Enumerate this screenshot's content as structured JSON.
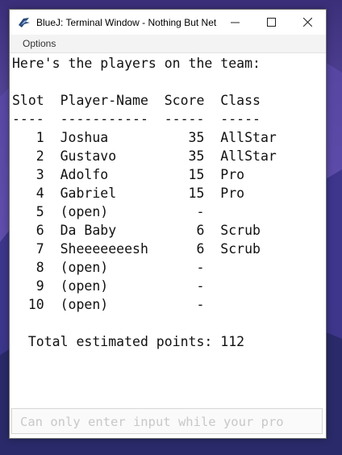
{
  "window": {
    "title": "BlueJ: Terminal Window - Nothing But Net",
    "minimize_glyph": "—",
    "maximize_glyph": "☐",
    "close_glyph": "✕"
  },
  "menu": {
    "options": "Options"
  },
  "terminal": {
    "lines": [
      "Here's the players on the team:",
      "",
      "Slot  Player-Name  Score  Class",
      "----  -----------  -----  -----",
      "   1  Joshua          35  AllStar",
      "   2  Gustavo         35  AllStar",
      "   3  Adolfo          15  Pro",
      "   4  Gabriel         15  Pro",
      "   5  (open)           -",
      "   6  Da Baby          6  Scrub",
      "   7  Sheeeeeeesh      6  Scrub",
      "   8  (open)           -",
      "   9  (open)           -",
      "  10  (open)           -",
      "",
      "  Total estimated points: 112"
    ]
  },
  "input": {
    "placeholder": "Can only enter input while your pro"
  }
}
